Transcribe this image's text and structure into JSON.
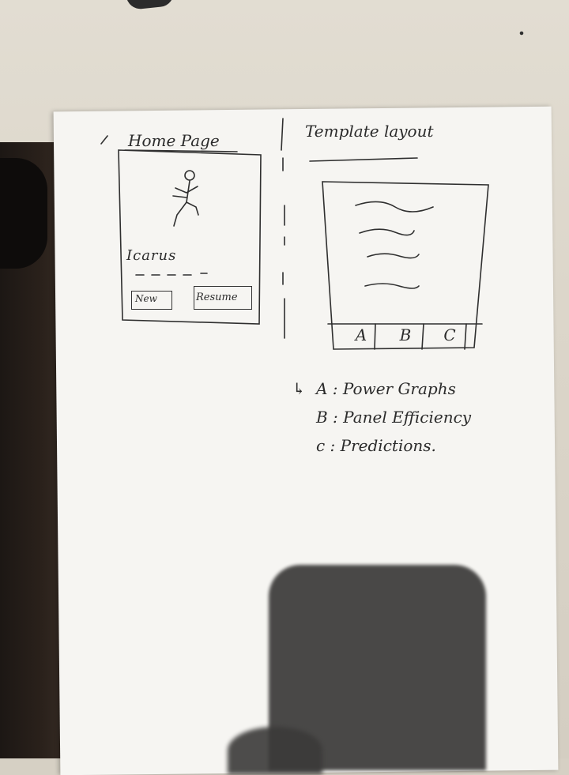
{
  "home": {
    "title": "Home Page",
    "app_name": "Icarus",
    "buttons": [
      "New",
      "Resume"
    ]
  },
  "template": {
    "title": "Template layout",
    "tabs": [
      "A",
      "B",
      "C"
    ],
    "legend": [
      {
        "key": "A",
        "label": "A : Power Graphs"
      },
      {
        "key": "B",
        "label": "B : Panel Efficiency"
      },
      {
        "key": "C",
        "label": "c : Predictions."
      }
    ]
  }
}
